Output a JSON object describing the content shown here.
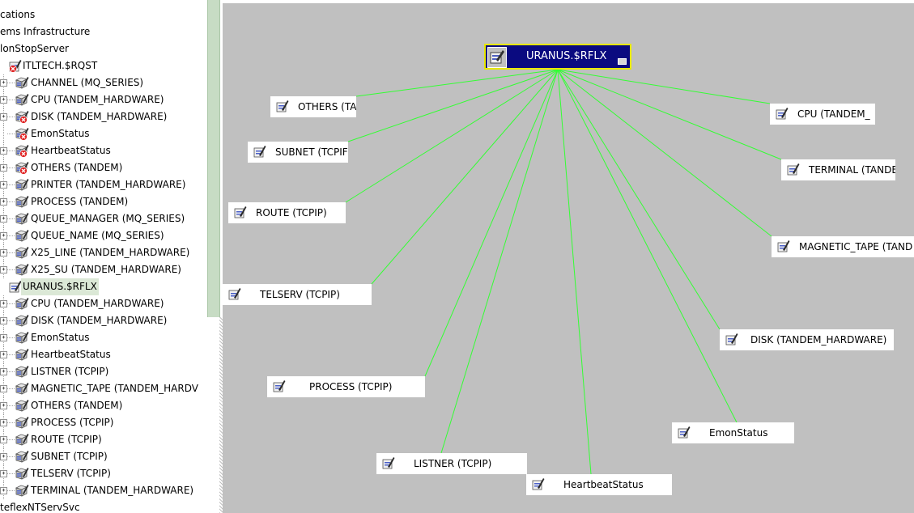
{
  "tree": {
    "items": [
      {
        "label": "cations",
        "level": 0,
        "icon": "none",
        "status": "ok"
      },
      {
        "label": "ems Infrastructure",
        "level": 0,
        "icon": "none",
        "status": "ok"
      },
      {
        "label": "lonStopServer",
        "level": 0,
        "icon": "none",
        "status": "ok"
      },
      {
        "label": "ITLTECH.$RQST",
        "level": 1,
        "icon": "node-icon",
        "status": "error"
      },
      {
        "label": "CHANNEL (MQ_SERIES)",
        "level": 2,
        "icon": "object-icon",
        "status": "ok"
      },
      {
        "label": "CPU (TANDEM_HARDWARE)",
        "level": 2,
        "icon": "object-icon",
        "status": "ok"
      },
      {
        "label": "DISK (TANDEM_HARDWARE)",
        "level": 2,
        "icon": "object-icon",
        "status": "error"
      },
      {
        "label": "EmonStatus",
        "level": 2,
        "icon": "object-icon",
        "status": "error",
        "leaf": true
      },
      {
        "label": "HeartbeatStatus",
        "level": 2,
        "icon": "object-icon",
        "status": "error"
      },
      {
        "label": "OTHERS (TANDEM)",
        "level": 2,
        "icon": "object-icon",
        "status": "error"
      },
      {
        "label": "PRINTER (TANDEM_HARDWARE)",
        "level": 2,
        "icon": "object-icon",
        "status": "ok"
      },
      {
        "label": "PROCESS (TANDEM)",
        "level": 2,
        "icon": "object-icon",
        "status": "ok"
      },
      {
        "label": "QUEUE_MANAGER (MQ_SERIES)",
        "level": 2,
        "icon": "object-icon",
        "status": "ok"
      },
      {
        "label": "QUEUE_NAME (MQ_SERIES)",
        "level": 2,
        "icon": "object-icon",
        "status": "ok"
      },
      {
        "label": "X25_LINE (TANDEM_HARDWARE)",
        "level": 2,
        "icon": "object-icon",
        "status": "ok"
      },
      {
        "label": "X25_SU (TANDEM_HARDWARE)",
        "level": 2,
        "icon": "object-icon",
        "status": "ok"
      },
      {
        "label": "URANUS.$RFLX",
        "level": 1,
        "icon": "node-icon",
        "status": "ok",
        "selected": true
      },
      {
        "label": "CPU (TANDEM_HARDWARE)",
        "level": 2,
        "icon": "object-icon",
        "status": "ok"
      },
      {
        "label": "DISK (TANDEM_HARDWARE)",
        "level": 2,
        "icon": "object-icon",
        "status": "ok"
      },
      {
        "label": "EmonStatus",
        "level": 2,
        "icon": "object-icon",
        "status": "ok"
      },
      {
        "label": "HeartbeatStatus",
        "level": 2,
        "icon": "object-icon",
        "status": "ok"
      },
      {
        "label": "LISTNER (TCPIP)",
        "level": 2,
        "icon": "object-icon",
        "status": "ok"
      },
      {
        "label": "MAGNETIC_TAPE (TANDEM_HARDV",
        "level": 2,
        "icon": "object-icon",
        "status": "ok"
      },
      {
        "label": "OTHERS (TANDEM)",
        "level": 2,
        "icon": "object-icon",
        "status": "ok"
      },
      {
        "label": "PROCESS (TCPIP)",
        "level": 2,
        "icon": "object-icon",
        "status": "ok"
      },
      {
        "label": "ROUTE (TCPIP)",
        "level": 2,
        "icon": "object-icon",
        "status": "ok"
      },
      {
        "label": "SUBNET (TCPIP)",
        "level": 2,
        "icon": "object-icon",
        "status": "ok"
      },
      {
        "label": "TELSERV (TCPIP)",
        "level": 2,
        "icon": "object-icon",
        "status": "ok"
      },
      {
        "label": "TERMINAL (TANDEM_HARDWARE)",
        "level": 2,
        "icon": "object-icon",
        "status": "ok"
      },
      {
        "label": "teflexNTServSvc",
        "level": 0,
        "icon": "none",
        "status": "ok"
      }
    ]
  },
  "graph": {
    "root": {
      "label": "URANUS.$RFLX"
    },
    "nodes": [
      {
        "label": "OTHERS (TA"
      },
      {
        "label": "SUBNET (TCPIF"
      },
      {
        "label": "ROUTE (TCPIP)"
      },
      {
        "label": "TELSERV (TCPIP)"
      },
      {
        "label": "PROCESS (TCPIP)"
      },
      {
        "label": "LISTNER (TCPIP)"
      },
      {
        "label": "HeartbeatStatus"
      },
      {
        "label": "EmonStatus"
      },
      {
        "label": "DISK (TANDEM_HARDWARE)"
      },
      {
        "label": "MAGNETIC_TAPE (TAND"
      },
      {
        "label": "TERMINAL (TANDE"
      },
      {
        "label": "CPU (TANDEM_"
      }
    ]
  },
  "colors": {
    "canvas_background": "#c0c0c0",
    "edge": "#33ff33",
    "root_fill": "#0a0a80",
    "root_border": "#e8e800",
    "selected_row": "#dbe8d6",
    "error_badge": "#e02020"
  }
}
